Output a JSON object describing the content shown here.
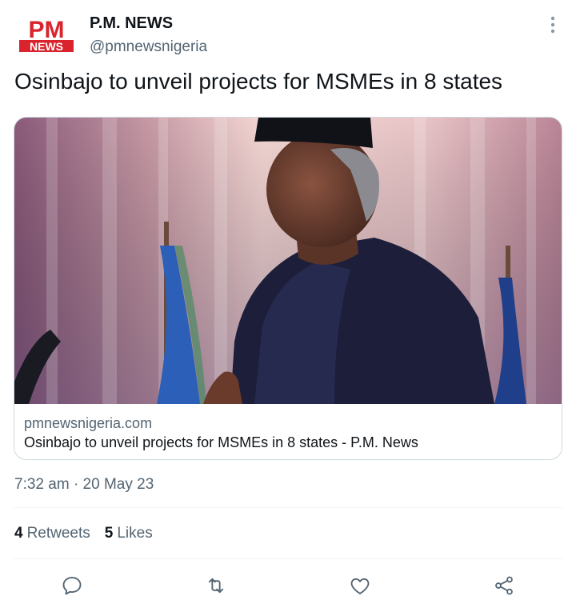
{
  "tweet": {
    "author_name": "P.M. NEWS",
    "author_handle": "@pmnewsnigeria",
    "text": "Osinbajo to unveil projects for MSMEs in 8 states",
    "logo": {
      "top": "PM",
      "bottom": "NEWS",
      "icon": "pm-news-logo"
    },
    "timestamp": "7:32 am",
    "separator": "·",
    "date": "20 May 23"
  },
  "link_card": {
    "domain": "pmnewsnigeria.com",
    "title": "Osinbajo to unveil projects for MSMEs in 8 states - P.M. News"
  },
  "stats": {
    "retweets_count": "4",
    "retweets_label": "Retweets",
    "likes_count": "5",
    "likes_label": "Likes"
  },
  "actions": [
    "reply-icon",
    "retweet-icon",
    "like-icon",
    "share-icon"
  ],
  "colors": {
    "text_primary": "#0f1419",
    "text_secondary": "#536471",
    "border": "#cfd9de",
    "logo_red": "#d9232d"
  }
}
